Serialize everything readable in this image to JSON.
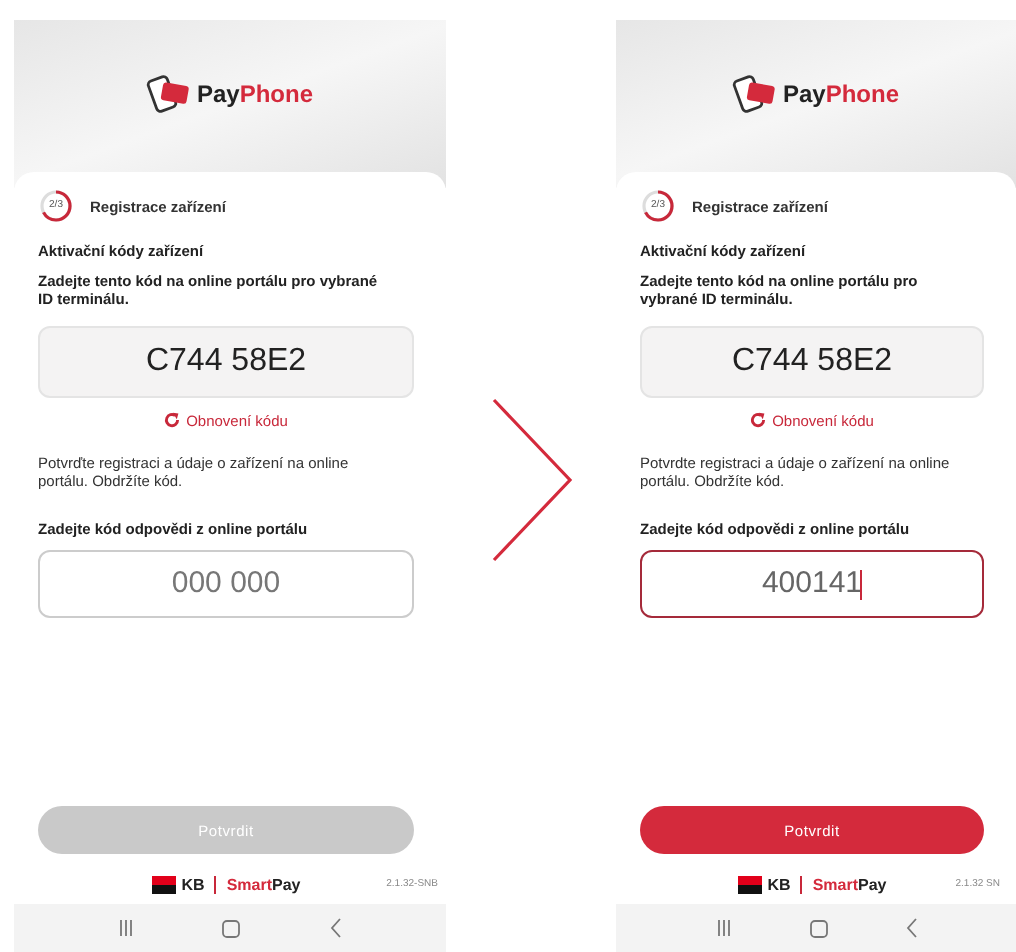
{
  "screens": [
    {
      "logo": {
        "first": "Pay",
        "second": "Phone"
      },
      "step": {
        "label": "2/3",
        "level": 0.67
      },
      "title": "Registrace zařízení",
      "section_title": "Aktivační kódy zařízení",
      "instruction": "Zadejte tento kód na online portálu pro vybrané ID terminálu.",
      "activation_code": "C744 58E2",
      "refresh_link": "Obnovení kódu",
      "confirm_text": "Potvrďte registraci a údaje o zařízení na online portálu. Obdržíte kód.",
      "response_label": "Zadejte kód odpovědi z online portálu",
      "response_field": {
        "placeholder": "000 000",
        "focused": false
      },
      "confirm_button": {
        "label": "Potvrdit",
        "disabled": true
      },
      "footer": {
        "bank": "KB",
        "first": "Smart",
        "second": "Pay"
      },
      "version": "2.1.32-SNB"
    },
    {
      "logo": {
        "first": "Pay",
        "second": "Phone"
      },
      "step": {
        "label": "2/3",
        "level": 0.67
      },
      "title": "Registrace zařízení",
      "section_title": "Aktivační kódy zařízení",
      "instruction": "Zadejte tento kód na online portálu pro vybrané ID terminálu.",
      "activation_code": "C744 58E2",
      "refresh_link": "Obnovení kódu",
      "confirm_text": "Potvrdte registraci a údaje o zařízení na online portálu. Obdržíte kód.",
      "response_label": "Zadejte kód odpovědi z online portálu",
      "response_field": {
        "value": "400141",
        "focused": true
      },
      "confirm_button": {
        "label": "Potvrdit",
        "disabled": false
      },
      "footer": {
        "bank": "KB",
        "first": "Smart",
        "second": "Pay"
      },
      "version": "2.1.32 SN"
    }
  ]
}
